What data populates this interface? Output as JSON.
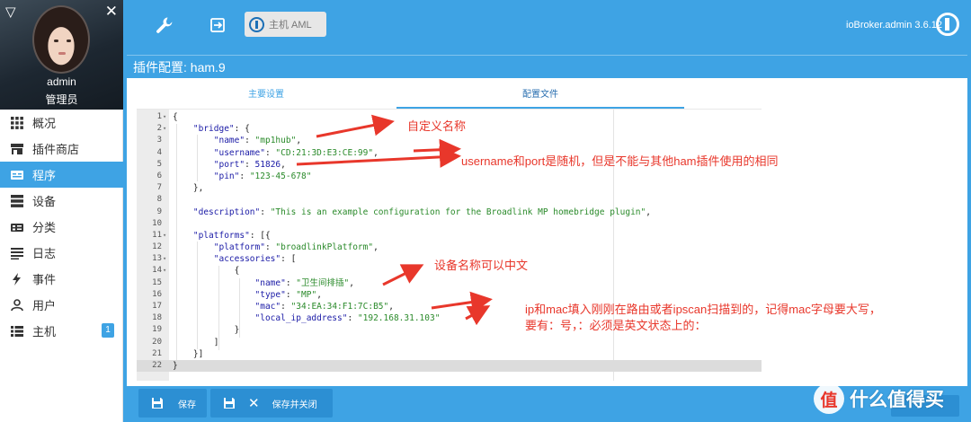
{
  "sidebar": {
    "username": "admin",
    "role": "管理员",
    "items": [
      {
        "label": "概况",
        "icon": "grid-icon"
      },
      {
        "label": "插件商店",
        "icon": "store-icon"
      },
      {
        "label": "程序",
        "icon": "instances-icon"
      },
      {
        "label": "设备",
        "icon": "objects-icon"
      },
      {
        "label": "分类",
        "icon": "enums-icon"
      },
      {
        "label": "日志",
        "icon": "log-icon"
      },
      {
        "label": "事件",
        "icon": "bolt-icon"
      },
      {
        "label": "用户",
        "icon": "user-icon"
      },
      {
        "label": "主机",
        "icon": "hosts-icon",
        "badge": "1"
      }
    ],
    "active_index": 2
  },
  "topbar": {
    "host_label": "主机 AML",
    "version": "ioBroker.admin 3.6.12"
  },
  "page": {
    "title": "插件配置: ham.9",
    "tabs": [
      "主要设置",
      "配置文件"
    ],
    "active_tab": 1
  },
  "editor": {
    "lines": [
      {
        "n": "1",
        "fold": "▾",
        "code": "{"
      },
      {
        "n": "2",
        "fold": "▾",
        "code": "    \"bridge\": {"
      },
      {
        "n": "3",
        "fold": "",
        "code": "        \"name\": \"mp1hub\","
      },
      {
        "n": "4",
        "fold": "",
        "code": "        \"username\": \"CD:21:3D:E3:CE:99\","
      },
      {
        "n": "5",
        "fold": "",
        "code": "        \"port\": 51826,"
      },
      {
        "n": "6",
        "fold": "",
        "code": "        \"pin\": \"123-45-678\""
      },
      {
        "n": "7",
        "fold": "",
        "code": "    },"
      },
      {
        "n": "8",
        "fold": "",
        "code": ""
      },
      {
        "n": "9",
        "fold": "",
        "code": "    \"description\": \"This is an example configuration for the Broadlink MP homebridge plugin\","
      },
      {
        "n": "10",
        "fold": "",
        "code": ""
      },
      {
        "n": "11",
        "fold": "▾",
        "code": "    \"platforms\": [{"
      },
      {
        "n": "12",
        "fold": "",
        "code": "        \"platform\": \"broadlinkPlatform\","
      },
      {
        "n": "13",
        "fold": "▾",
        "code": "        \"accessories\": ["
      },
      {
        "n": "14",
        "fold": "▾",
        "code": "            {"
      },
      {
        "n": "15",
        "fold": "",
        "code": "                \"name\": \"卫生间排插\","
      },
      {
        "n": "16",
        "fold": "",
        "code": "                \"type\": \"MP\","
      },
      {
        "n": "17",
        "fold": "",
        "code": "                \"mac\": \"34:EA:34:F1:7C:B5\","
      },
      {
        "n": "18",
        "fold": "",
        "code": "                \"local_ip_address\": \"192.168.31.103\""
      },
      {
        "n": "19",
        "fold": "",
        "code": "            }"
      },
      {
        "n": "20",
        "fold": "",
        "code": "        ]"
      },
      {
        "n": "21",
        "fold": "",
        "code": "    }]"
      },
      {
        "n": "22",
        "fold": "",
        "code": "}"
      }
    ],
    "active_line": 22
  },
  "annotations": {
    "note1": "自定义名称",
    "note2": "username和port是随机，但是不能与其他ham插件使用的相同",
    "note3": "设备名称可以中文",
    "note4_line1": "ip和mac填入刚刚在路由或者ipscan扫描到的，记得mac字母要大写，",
    "note4_line2": "要有：号，：必须是英文状态上的：",
    "color": "#e8372b"
  },
  "footer": {
    "save_label": "保存",
    "save_close_label": "保存并关闭"
  },
  "watermark": {
    "circle_text": "值",
    "text": "什么值得买"
  },
  "colors": {
    "accent": "#3ea3e4",
    "button": "#2c8fd3",
    "annotation": "#e8372b"
  }
}
